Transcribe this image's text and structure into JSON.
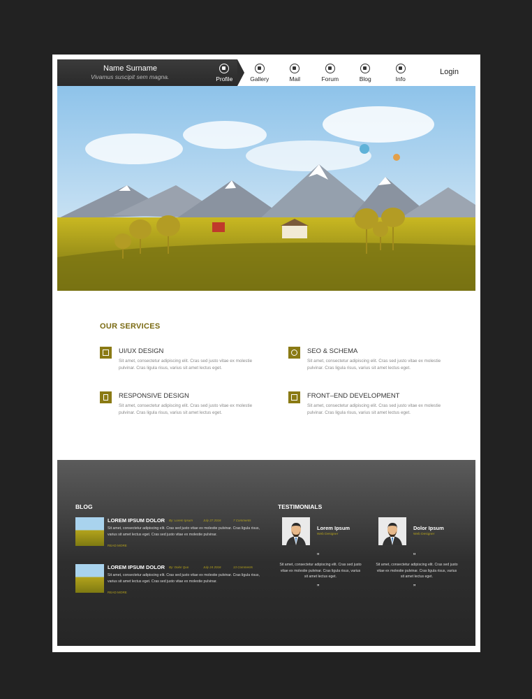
{
  "header": {
    "name": "Name Surname",
    "tagline": "Vivamus suscipit sem magna.",
    "nav": [
      {
        "label": "Profile",
        "icon": "user-icon"
      },
      {
        "label": "Gallery",
        "icon": "camera-icon"
      },
      {
        "label": "Mail",
        "icon": "mail-icon"
      },
      {
        "label": "Forum",
        "icon": "forum-icon"
      },
      {
        "label": "Blog",
        "icon": "pen-icon"
      },
      {
        "label": "Info",
        "icon": "info-icon"
      }
    ],
    "login": "Login"
  },
  "services": {
    "title": "OUR SERVICES",
    "items": [
      {
        "title": "UI/UX  DESIGN",
        "icon": "layout-icon",
        "desc": "Sit amet, consectetur adipiscing elit. Cras sed justo vitae ex molestie pulvinar. Cras ligula risus, varius sit amet lectus eget."
      },
      {
        "title": "SEO & SCHEMA",
        "icon": "search-icon",
        "desc": "Sit amet, consectetur adipiscing elit. Cras sed justo vitae ex molestie pulvinar. Cras ligula risus, varius sit amet lectus eget."
      },
      {
        "title": "RESPONSIVE  DESIGN",
        "icon": "mobile-icon",
        "desc": "Sit amet, consectetur adipiscing elit. Cras sed justo vitae ex molestie pulvinar. Cras ligula risus, varius sit amet lectus eget."
      },
      {
        "title": "FRONT–END  DEVELOPMENT",
        "icon": "code-icon",
        "desc": "Sit amet, consectetur adipiscing elit. Cras sed justo vitae ex molestie pulvinar. Cras ligula risus, varius sit amet lectus eget."
      }
    ]
  },
  "blog": {
    "title": "BLOG",
    "posts": [
      {
        "title": "LOREM IPSUM DOLOR",
        "author": "By: Lorem Ipsum",
        "date": "July 27 2016",
        "comments": "7 Comments",
        "desc": "Sit amet, consectetur adipiscing elit. Cras sed justo vitae ex molestie pulvinar. Cras ligula risus, varius sit amet lectus eget. Cras sed justo vitae ex molestie pulvinar.",
        "read_more": "READ MORE"
      },
      {
        "title": "LOREM IPSUM DOLOR",
        "author": "By: Dolor Quo",
        "date": "July 24 2016",
        "comments": "13 Comments",
        "desc": "Sit amet, consectetur adipiscing elit. Cras sed justo vitae ex molestie pulvinar. Cras ligula risus, varius sit amet lectus eget. Cras sed justo vitae ex molestie pulvinar.",
        "read_more": "READ MORE"
      }
    ]
  },
  "testimonials": {
    "title": "TESTIMONIALS",
    "items": [
      {
        "name": "Lorem Ipsum",
        "role": "Web Designer",
        "quote": "Sit amet, consectetur adipiscing elit. Cras sed justo vitae ex molestie pulvinar. Cras ligula risus, varius sit amet lectus eget."
      },
      {
        "name": "Dolor Ipsum",
        "role": "Web Designer",
        "quote": "Sit amet, consectetur adipiscing elit. Cras sed justo vitae ex molestie pulvinar. Cras ligula risus, varius sit amet lectus eget."
      }
    ],
    "quote_open": "“",
    "quote_close": "”"
  },
  "colors": {
    "accent": "#8a7a14",
    "dark": "#2e2e2e",
    "sky": "#a9d3ee",
    "field": "#b3a31c"
  }
}
